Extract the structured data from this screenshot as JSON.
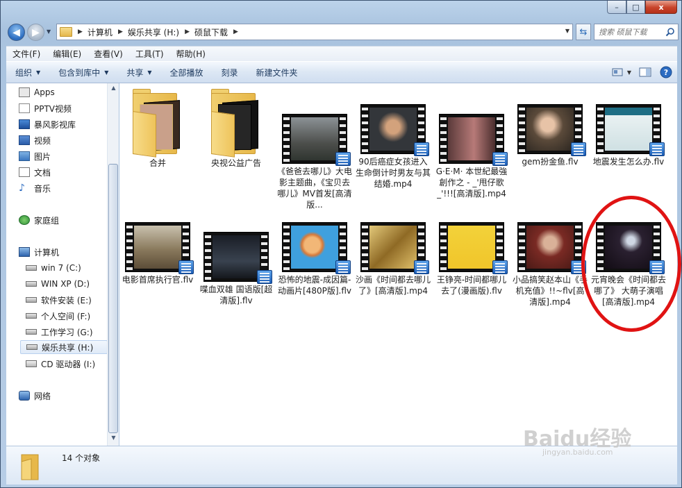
{
  "window": {
    "caption_min": "–",
    "caption_max": "□",
    "caption_close": "x"
  },
  "address": {
    "crumbs": [
      "计算机",
      "娱乐共享 (H:)",
      "硕鼠下载"
    ],
    "search_placeholder": "搜索 硕鼠下载"
  },
  "menu": [
    "文件(F)",
    "编辑(E)",
    "查看(V)",
    "工具(T)",
    "帮助(H)"
  ],
  "toolbar": {
    "organize": "组织",
    "include_library": "包含到库中",
    "share": "共享",
    "play_all": "全部播放",
    "burn": "刻录",
    "new_folder": "新建文件夹"
  },
  "nav": {
    "favorites": [
      "Apps",
      "PPTV视频",
      "暴风影视库",
      "视频",
      "图片",
      "文档",
      "音乐"
    ],
    "homegroup": "家庭组",
    "computer": "计算机",
    "drives": [
      "win 7 (C:)",
      "WIN XP (D:)",
      "软件安装 (E:)",
      "个人空间 (F:)",
      "工作学习 (G:)",
      "娱乐共享 (H:)",
      "CD 驱动器 (I:)"
    ],
    "network": "网络"
  },
  "files": [
    {
      "name": "合并",
      "kind": "folder"
    },
    {
      "name": "央视公益广告",
      "kind": "folder"
    },
    {
      "name": "《爸爸去哪儿》大电影主题曲，《宝贝去哪儿》MV首发[高清版...",
      "kind": "video"
    },
    {
      "name": "90后癌症女孩进入生命倒计时男友与其结婚.mp4",
      "kind": "video"
    },
    {
      "name": "G·E·M· 本世紀最強創作之 - _'甩仔歌_'!!![高清版].mp4",
      "kind": "video"
    },
    {
      "name": "gem扮金鱼.flv",
      "kind": "video"
    },
    {
      "name": "地震发生怎么办.flv",
      "kind": "video"
    },
    {
      "name": "电影首席执行官.flv",
      "kind": "video"
    },
    {
      "name": "喋血双雄 国语版[超清版].flv",
      "kind": "video"
    },
    {
      "name": "恐怖的地震-成因篇-动画片[480P版].flv",
      "kind": "video"
    },
    {
      "name": "沙画《时间都去哪儿了》[高清版].mp4",
      "kind": "video"
    },
    {
      "name": "王铮亮-时间都哪儿去了(漫画版).flv",
      "kind": "video"
    },
    {
      "name": "小品搞笑赵本山《手机充值》!!~flv[高清版].mp4",
      "kind": "video"
    },
    {
      "name": "元宵晚会《时间都去哪了》 大萌子演唱[高清版].mp4",
      "kind": "video"
    }
  ],
  "details": {
    "count": "14 个对象"
  },
  "watermark": {
    "brand": "Baidu经验",
    "url": "jingyan.baidu.com"
  }
}
